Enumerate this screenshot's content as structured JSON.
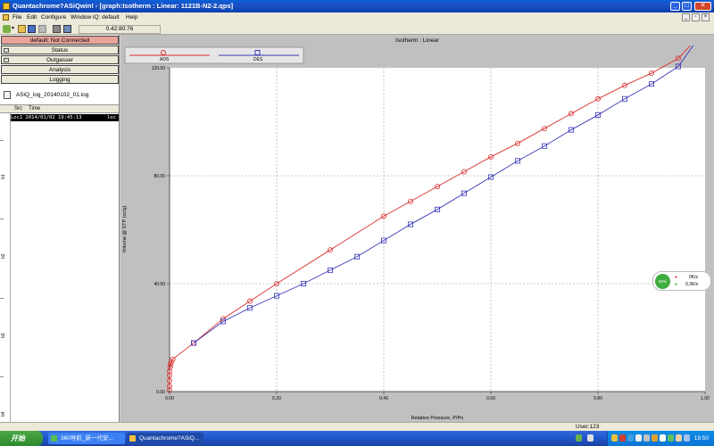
{
  "window": {
    "title": "Quantachrome?ASiQwin! - [graph:Isotherm :  Linear: 1121B-N2-2.qps]"
  },
  "menu": [
    "File",
    "Edit",
    "Configure",
    "Window",
    "iQ: default",
    "Help"
  ],
  "toolbar": {
    "coord": "0.42:80.76"
  },
  "left": {
    "status_button": "default: Not Connected",
    "buttons": [
      "Status",
      "Outgasser",
      "Analysis",
      "Logging"
    ],
    "logfile": "ASiQ_log_20140102_01.log",
    "table_headers": [
      "Src",
      "Time"
    ],
    "rows": [
      {
        "src": "Loc",
        "time": "1 2014/01/02 19:45:13",
        "extra": "loc"
      }
    ],
    "ruler": [
      "b1",
      "b2",
      "b3",
      "b4"
    ]
  },
  "graph": {
    "title": "Isotherm :  Linear",
    "legend": [
      "ADS",
      "DES"
    ]
  },
  "chart_data": {
    "type": "line",
    "xlabel": "Relative Pressure, P/Po",
    "ylabel": "Volume @ STP (cc/g)",
    "xlim": [
      0,
      1.0
    ],
    "ylim": [
      0,
      120
    ],
    "xticks": [
      "0.00",
      "0.20",
      "0.40",
      "0.60",
      "0.80",
      "1.00"
    ],
    "yticks": [
      "0.00",
      "40.00",
      "80.00",
      "120.00"
    ],
    "series": [
      {
        "name": "ADS",
        "color": "#d9302f",
        "marker": "circle",
        "x": [
          0.0,
          0.0,
          0.0,
          0.0,
          0.0,
          0.001,
          0.002,
          0.003,
          0.006,
          0.045,
          0.1,
          0.15,
          0.2,
          0.3,
          0.4,
          0.45,
          0.5,
          0.55,
          0.6,
          0.65,
          0.7,
          0.75,
          0.8,
          0.85,
          0.9,
          0.95,
          0.995
        ],
        "y": [
          0.5,
          2.0,
          4.0,
          6.0,
          7.5,
          9.0,
          10.0,
          11.0,
          12.0,
          18.0,
          27.0,
          33.5,
          40.0,
          52.5,
          65.0,
          70.5,
          76.0,
          81.5,
          87.0,
          92.0,
          97.5,
          103.0,
          108.5,
          113.5,
          118.0,
          123.5,
          133.0
        ]
      },
      {
        "name": "DES",
        "color": "#3838b8",
        "marker": "square",
        "x": [
          0.995,
          0.95,
          0.9,
          0.85,
          0.8,
          0.75,
          0.7,
          0.65,
          0.6,
          0.55,
          0.5,
          0.45,
          0.4,
          0.35,
          0.3,
          0.25,
          0.2,
          0.15,
          0.1,
          0.045
        ],
        "y": [
          133.0,
          120.5,
          114.0,
          108.5,
          102.5,
          97.0,
          91.0,
          85.5,
          79.5,
          73.5,
          67.5,
          62.0,
          56.0,
          50.0,
          45.0,
          40.0,
          35.5,
          31.0,
          26.0,
          18.0
        ]
      }
    ]
  },
  "netwidget": {
    "percent": "56%",
    "up": "0K/s",
    "down": "0.3K/s"
  },
  "statusbar": {
    "user": "User:123"
  },
  "taskbar": {
    "start": "开始",
    "tasks": [
      "360导航_新一代安...",
      "Quantachrome?ASiQ..."
    ],
    "clock": "19:50"
  },
  "colors": {
    "titlebar": "#0a5fd8",
    "taskbar": "#245ed6",
    "status_red": "#e8a49a"
  }
}
